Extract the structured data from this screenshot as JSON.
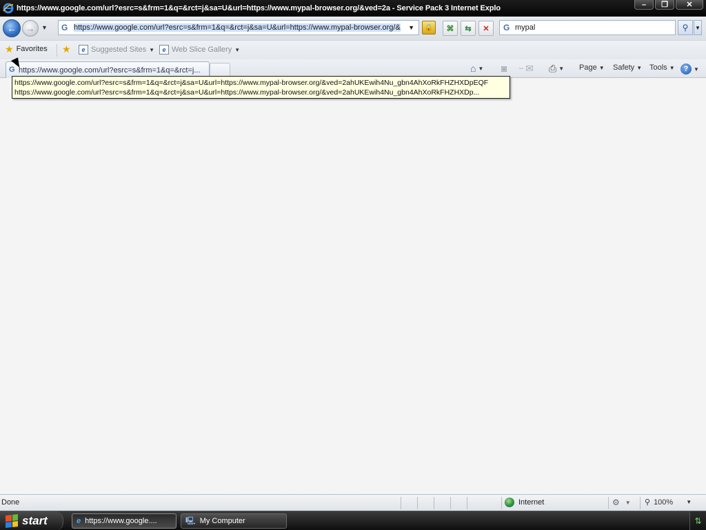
{
  "window": {
    "title": "https://www.google.com/url?esrc=s&frm=1&q=&rct=j&sa=U&url=https://www.mypal-browser.org/&ved=2a - Service Pack 3 Internet Explo",
    "minimize": "–",
    "maximize": "❐",
    "close": "✕"
  },
  "nav": {
    "back_icon": "back-arrow-icon",
    "forward_icon": "forward-arrow-icon",
    "address_provider": "G",
    "address_value": "https://www.google.com/url?esrc=s&frm=1&q=&rct=j&sa=U&url=https://www.mypal-browser.org/&",
    "search_provider": "G",
    "search_value": "mypal"
  },
  "favorites_bar": {
    "favorites_label": "Favorites",
    "suggested_sites_label": "Suggested Sites",
    "web_slice_gallery_label": "Web Slice Gallery"
  },
  "tabs": {
    "active_title": "https://www.google.com/url?esrc=s&frm=1&q=&rct=j..."
  },
  "command_bar": {
    "page_label": "Page",
    "safety_label": "Safety",
    "tools_label": "Tools",
    "help_label": "?"
  },
  "tooltip": {
    "line1": "https://www.google.com/url?esrc=s&frm=1&q=&rct=j&sa=U&url=https://www.mypal-browser.org/&ved=2ahUKEwih4Nu_gbn4AhXoRkFHZHXDpEQF",
    "line2": "https://www.google.com/url?esrc=s&frm=1&q=&rct=j&sa=U&url=https://www.mypal-browser.org/&ved=2ahUKEwih4Nu_gbn4AhXoRkFHZHXDp..."
  },
  "status_bar": {
    "status_text": "Done",
    "zone_label": "Internet",
    "zoom_label": "100%"
  },
  "taskbar": {
    "start_label": "start",
    "tasks": [
      {
        "label": "https://www.google...."
      },
      {
        "label": "My Computer"
      }
    ]
  }
}
